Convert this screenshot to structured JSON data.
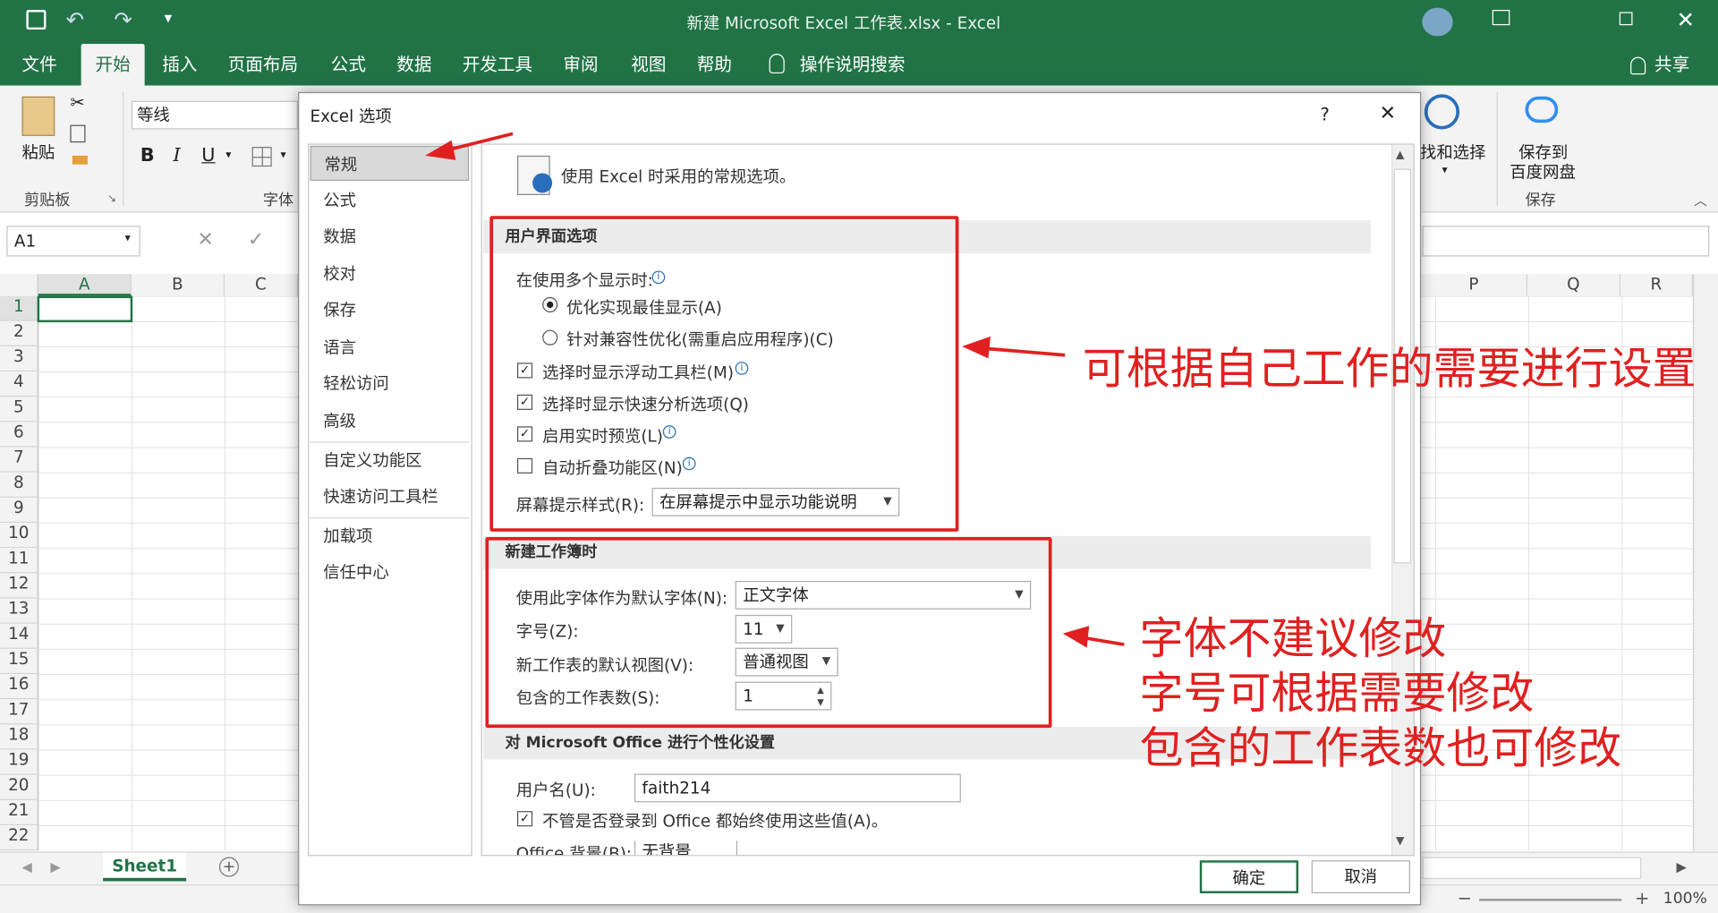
{
  "window": {
    "title": "新建 Microsoft Excel 工作表.xlsx  -  Excel"
  },
  "ribbon_tabs": [
    "文件",
    "开始",
    "插入",
    "页面布局",
    "公式",
    "数据",
    "开发工具",
    "审阅",
    "视图",
    "帮助",
    "操作说明搜索"
  ],
  "share_label": "共享",
  "ribbon": {
    "paste_label": "粘贴",
    "clipboard_group": "剪贴板",
    "font_name": "等线",
    "font_group": "字体",
    "bold": "B",
    "italic": "I",
    "underline": "U",
    "find_select": "找和选择",
    "save_to_baidu_line1": "保存到",
    "save_to_baidu_line2": "百度网盘",
    "save_group": "保存"
  },
  "formula_bar": {
    "name_box": "A1"
  },
  "columns_left": [
    "A",
    "B",
    "C"
  ],
  "columns_right": [
    "P",
    "Q",
    "R"
  ],
  "rows": [
    "1",
    "2",
    "3",
    "4",
    "5",
    "6",
    "7",
    "8",
    "9",
    "10",
    "11",
    "12",
    "13",
    "14",
    "15",
    "16",
    "17",
    "18",
    "19",
    "20",
    "21",
    "22"
  ],
  "sheet_tab": "Sheet1",
  "zoom": "100%",
  "dialog": {
    "title": "Excel 选项",
    "help": "?",
    "close": "✕",
    "nav": [
      "常规",
      "公式",
      "数据",
      "校对",
      "保存",
      "语言",
      "轻松访问",
      "高级",
      "自定义功能区",
      "快速访问工具栏",
      "加载项",
      "信任中心"
    ],
    "intro": "使用 Excel 时采用的常规选项。",
    "ui_section": "用户界面选项",
    "multi_display": "在使用多个显示时:",
    "opt_best": "优化实现最佳显示(A)",
    "opt_compat": "针对兼容性优化(需重启应用程序)(C)",
    "chk_mini_toolbar": "选择时显示浮动工具栏(M)",
    "chk_quick_analysis": "选择时显示快速分析选项(Q)",
    "chk_live_preview": "启用实时预览(L)",
    "chk_collapse_ribbon": "自动折叠功能区(N)",
    "screentip_label": "屏幕提示样式(R):",
    "screentip_value": "在屏幕提示中显示功能说明",
    "new_wb_section": "新建工作簿时",
    "font_label": "使用此字体作为默认字体(N):",
    "font_value": "正文字体",
    "size_label": "字号(Z):",
    "size_value": "11",
    "view_label": "新工作表的默认视图(V):",
    "view_value": "普通视图",
    "sheets_label": "包含的工作表数(S):",
    "sheets_value": "1",
    "office_section": "对 Microsoft Office 进行个性化设置",
    "username_label": "用户名(U):",
    "username_value": "faith214",
    "always_use": "不管是否登录到 Office 都始终使用这些值(A)。",
    "bg_label": "Office 背景(B):",
    "bg_value": "无背景",
    "ok": "确定",
    "cancel": "取消"
  },
  "annotations": {
    "note1": "可根据自己工作的需要进行设置",
    "note2_line1": "字体不建议修改",
    "note2_line2": "字号可根据需要修改",
    "note2_line3": "包含的工作表数也可修改"
  },
  "colors": {
    "excel_green": "#217346",
    "annotation_red": "#e02020"
  }
}
